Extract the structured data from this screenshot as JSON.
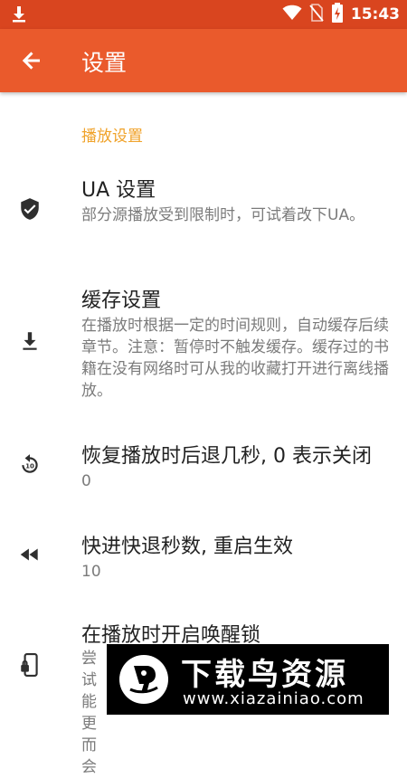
{
  "status_bar": {
    "time": "15:43",
    "icons": [
      "download-icon",
      "wifi-icon",
      "no-sim-icon",
      "battery-charging-icon"
    ]
  },
  "app_bar": {
    "back_icon": "arrow-back-icon",
    "title": "设置"
  },
  "section": {
    "title": "播放设置"
  },
  "items": [
    {
      "icon": "shield-check-icon",
      "title": "UA 设置",
      "summary": "部分源播放受到限制时，可试着改下UA。"
    },
    {
      "icon": "download-icon",
      "title": "缓存设置",
      "summary": "在播放时根据一定的时间规则，自动缓存后续章节。注意：暂停时不触发缓存。缓存过的书籍在没有网络时可从我的收藏打开进行离线播放。"
    },
    {
      "icon": "replay-10-icon",
      "title": "恢复播放时后退几秒, 0 表示关闭",
      "summary": "0"
    },
    {
      "icon": "fast-rewind-icon",
      "title": "快进快退秒数, 重启生效",
      "summary": "10"
    },
    {
      "icon": "phone-lock-icon",
      "title": "在播放时开启唤醒锁",
      "summary": "尝试 能更 而会"
    }
  ],
  "watermark": {
    "name": "下载鸟资源",
    "url": "www.xiazainiao.com"
  }
}
